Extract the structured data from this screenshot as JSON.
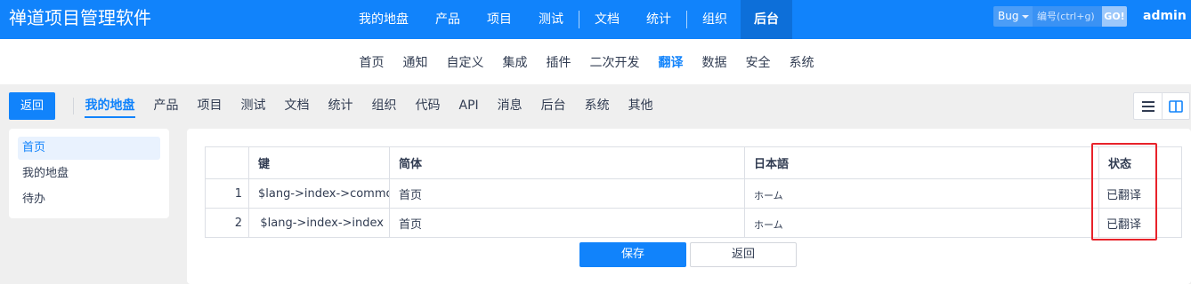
{
  "header": {
    "brand": "禅道项目管理软件",
    "nav": [
      {
        "label": "我的地盘"
      },
      {
        "label": "产品"
      },
      {
        "label": "项目"
      },
      {
        "label": "测试"
      },
      {
        "label": "文档"
      },
      {
        "label": "统计"
      },
      {
        "label": "组织"
      },
      {
        "label": "后台",
        "active": true
      }
    ],
    "search": {
      "type": "Bug",
      "placeholder": "编号(ctrl+g)",
      "go": "GO!"
    },
    "user": "admin"
  },
  "subnav": [
    {
      "label": "首页"
    },
    {
      "label": "通知"
    },
    {
      "label": "自定义"
    },
    {
      "label": "集成"
    },
    {
      "label": "插件"
    },
    {
      "label": "二次开发"
    },
    {
      "label": "翻译",
      "active": true
    },
    {
      "label": "数据"
    },
    {
      "label": "安全"
    },
    {
      "label": "系统"
    }
  ],
  "toolbar": {
    "back": "返回",
    "modules": [
      {
        "label": "我的地盘",
        "active": true
      },
      {
        "label": "产品"
      },
      {
        "label": "项目"
      },
      {
        "label": "测试"
      },
      {
        "label": "文档"
      },
      {
        "label": "统计"
      },
      {
        "label": "组织"
      },
      {
        "label": "代码"
      },
      {
        "label": "API"
      },
      {
        "label": "消息"
      },
      {
        "label": "后台"
      },
      {
        "label": "系统"
      },
      {
        "label": "其他"
      }
    ],
    "view_icons": [
      "list-icon",
      "split-view-icon"
    ]
  },
  "sidebar": [
    {
      "label": "首页",
      "active": true
    },
    {
      "label": "我的地盘"
    },
    {
      "label": "待办"
    }
  ],
  "table": {
    "headers": {
      "key": "键",
      "simplified": "简体",
      "japanese": "日本語",
      "status": "状态"
    },
    "rows": [
      {
        "num": "1",
        "key": "$lang->index->common",
        "simplified": "首页",
        "japanese": "ホーム",
        "status": "已翻译"
      },
      {
        "num": "2",
        "key": "$lang->index->index",
        "simplified": "首页",
        "japanese": "ホーム",
        "status": "已翻译"
      }
    ]
  },
  "actions": {
    "save": "保存",
    "back": "返回"
  },
  "colors": {
    "primary": "#1183fb",
    "highlight": "#e8222a"
  }
}
